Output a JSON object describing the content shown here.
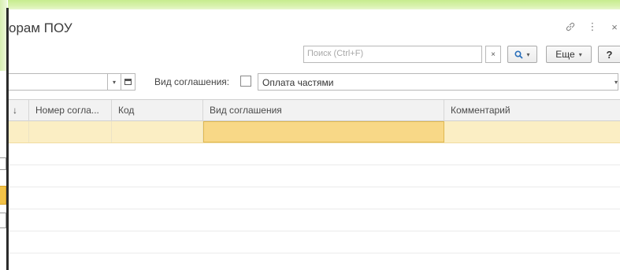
{
  "window": {
    "title": "орам ПОУ"
  },
  "header": {
    "icons": [
      "link-icon",
      "more-vertical-icon",
      "close-icon"
    ],
    "close_glyph": "×",
    "more_glyph": "⋮"
  },
  "search": {
    "placeholder": "Поиск (Ctrl+F)",
    "clear_glyph": "×",
    "search_icon": "search-icon",
    "more_label": "Еще",
    "help_label": "?",
    "dropdown_glyph": "▾"
  },
  "filter": {
    "period_value": "",
    "agreement_type_label": "Вид соглашения:",
    "agreement_type_checked": false,
    "agreement_type_value": "Оплата частями"
  },
  "table": {
    "columns": [
      {
        "label": "↓"
      },
      {
        "label": "Номер согла..."
      },
      {
        "label": "Код"
      },
      {
        "label": "Вид соглашения"
      },
      {
        "label": "Комментарий"
      }
    ],
    "rows": [
      {
        "selected": true,
        "cells": [
          "",
          "",
          "",
          "",
          ""
        ]
      },
      {
        "selected": false,
        "cells": [
          "",
          "",
          "",
          "",
          ""
        ]
      },
      {
        "selected": false,
        "cells": [
          "",
          "",
          "",
          "",
          ""
        ]
      },
      {
        "selected": false,
        "cells": [
          "",
          "",
          "",
          "",
          ""
        ]
      },
      {
        "selected": false,
        "cells": [
          "",
          "",
          "",
          "",
          ""
        ]
      },
      {
        "selected": false,
        "cells": [
          "",
          "",
          "",
          "",
          ""
        ]
      },
      {
        "selected": false,
        "cells": [
          "",
          "",
          "",
          "",
          ""
        ]
      }
    ]
  },
  "colors": {
    "accent_green": "#c7ec8e",
    "selected_row": "#fbeec4",
    "selected_cell": "#f8d887",
    "search_icon_blue": "#2a6fba"
  }
}
